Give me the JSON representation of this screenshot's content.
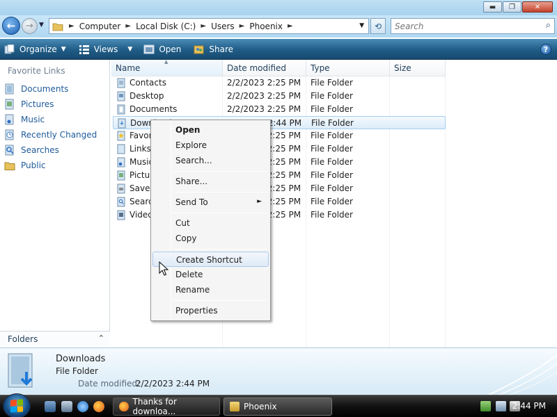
{
  "window": {
    "minimize_glyph": "▬",
    "maximize_glyph": "❐",
    "close_glyph": "✕"
  },
  "navigation": {
    "back_glyph": "←",
    "forward_glyph": "→",
    "history_glyph": "▼"
  },
  "address": {
    "crumbs": [
      "Computer",
      "Local Disk (C:)",
      "Users",
      "Phoenix"
    ],
    "separator": "►",
    "dropdown_glyph": "▼",
    "refresh_glyph": "⟲"
  },
  "search": {
    "placeholder": "Search",
    "icon": "magnifier-icon"
  },
  "toolbar": {
    "organize": "Organize",
    "views": "Views",
    "open": "Open",
    "share": "Share",
    "caret": "▼",
    "help": "?"
  },
  "nav_pane": {
    "header": "Favorite Links",
    "links": [
      {
        "label": "Documents",
        "icon": "documents-icon"
      },
      {
        "label": "Pictures",
        "icon": "pictures-icon"
      },
      {
        "label": "Music",
        "icon": "music-icon"
      },
      {
        "label": "Recently Changed",
        "icon": "recently-changed-icon"
      },
      {
        "label": "Searches",
        "icon": "searches-icon"
      },
      {
        "label": "Public",
        "icon": "public-folder-icon"
      }
    ],
    "folders_label": "Folders",
    "folders_toggle": "⌃"
  },
  "columns": {
    "name": "Name",
    "date": "Date modified",
    "type": "Type",
    "size": "Size",
    "sort_glyph": "▲"
  },
  "files": [
    {
      "name": "Contacts",
      "date": "2/2/2023 2:25 PM",
      "type": "File Folder"
    },
    {
      "name": "Desktop",
      "date": "2/2/2023 2:25 PM",
      "type": "File Folder"
    },
    {
      "name": "Documents",
      "date": "2/2/2023 2:25 PM",
      "type": "File Folder"
    },
    {
      "name": "Downloads",
      "date": "2/2/2023 2:44 PM",
      "type": "File Folder"
    },
    {
      "name": "Favorites",
      "date": "2/2/2023 2:25 PM",
      "type": "File Folder"
    },
    {
      "name": "Links",
      "date": "2/2/2023 2:25 PM",
      "type": "File Folder"
    },
    {
      "name": "Music",
      "date": "2/2/2023 2:25 PM",
      "type": "File Folder"
    },
    {
      "name": "Pictures",
      "date": "2/2/2023 2:25 PM",
      "type": "File Folder"
    },
    {
      "name": "Saved Games",
      "date": "2/2/2023 2:25 PM",
      "type": "File Folder"
    },
    {
      "name": "Searches",
      "date": "2/2/2023 2:25 PM",
      "type": "File Folder"
    },
    {
      "name": "Videos",
      "date": "2/2/2023 2:25 PM",
      "type": "File Folder"
    }
  ],
  "context_menu": {
    "open": "Open",
    "explore": "Explore",
    "search": "Search...",
    "share": "Share...",
    "send_to": "Send To",
    "submenu_glyph": "►",
    "cut": "Cut",
    "copy": "Copy",
    "create_shortcut": "Create Shortcut",
    "delete": "Delete",
    "rename": "Rename",
    "properties": "Properties"
  },
  "details": {
    "name": "Downloads",
    "type": "File Folder",
    "modified_label": "Date modified:",
    "modified_value": "2/2/2023 2:44 PM"
  },
  "taskbar": {
    "tasks": [
      {
        "label": "Thanks for downloa...",
        "icon": "firefox-icon"
      },
      {
        "label": "Phoenix",
        "icon": "folder-icon"
      }
    ],
    "clock": "2:44 PM"
  },
  "colors": {
    "toolbar": "#1f5c86",
    "link": "#1f5a9a",
    "selection": "#dcecfa",
    "taskbar": "#111111"
  }
}
